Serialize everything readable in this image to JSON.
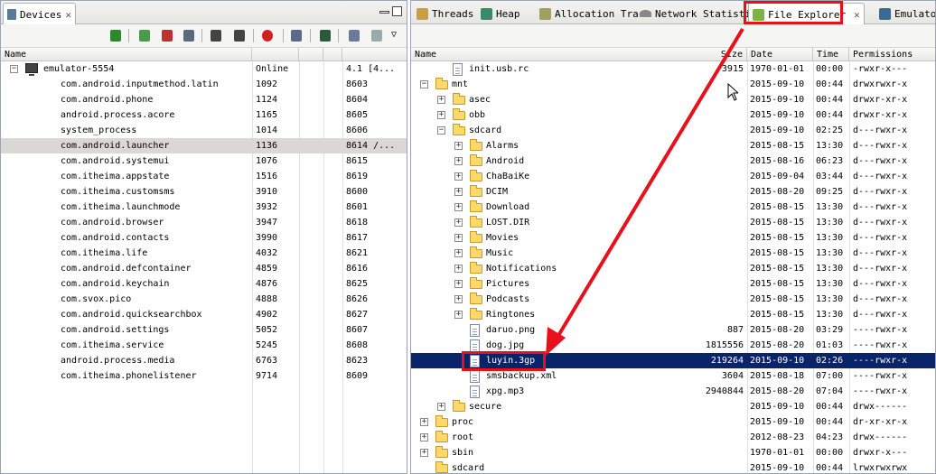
{
  "colors": {
    "accent_red": "#e8101a",
    "selection": "#0a246a",
    "highlight_row": "#d9d8d4"
  },
  "devices_view": {
    "tab_label": "Devices",
    "columns": [
      "Name",
      "",
      "",
      ""
    ],
    "toolbar_icons": [
      "debug-bug-icon",
      "update-heap-icon",
      "dump-hprof-icon",
      "cause-gc-icon",
      "update-threads-icon",
      "start-method-profiling-icon",
      "stop-process-icon",
      "screen-capture-icon",
      "systrace-icon",
      "opengl-trace-icon",
      "reset-adb-icon",
      "view-menu-icon"
    ],
    "rows": [
      {
        "name": "emulator-5554",
        "pid": "Online",
        "port": "4.1 [4...",
        "kind": "device"
      },
      {
        "name": "com.android.inputmethod.latin",
        "pid": "1092",
        "port": "8603"
      },
      {
        "name": "com.android.phone",
        "pid": "1124",
        "port": "8604"
      },
      {
        "name": "android.process.acore",
        "pid": "1165",
        "port": "8605"
      },
      {
        "name": "system_process",
        "pid": "1014",
        "port": "8606"
      },
      {
        "name": "com.android.launcher",
        "pid": "1136",
        "port": "8614 /...",
        "highlight": true
      },
      {
        "name": "com.android.systemui",
        "pid": "1076",
        "port": "8615"
      },
      {
        "name": "com.itheima.appstate",
        "pid": "1516",
        "port": "8619"
      },
      {
        "name": "com.itheima.customsms",
        "pid": "3910",
        "port": "8600"
      },
      {
        "name": "com.itheima.launchmode",
        "pid": "3932",
        "port": "8601"
      },
      {
        "name": "com.android.browser",
        "pid": "3947",
        "port": "8618"
      },
      {
        "name": "com.android.contacts",
        "pid": "3990",
        "port": "8617"
      },
      {
        "name": "com.itheima.life",
        "pid": "4032",
        "port": "8621"
      },
      {
        "name": "com.android.defcontainer",
        "pid": "4859",
        "port": "8616"
      },
      {
        "name": "com.android.keychain",
        "pid": "4876",
        "port": "8625"
      },
      {
        "name": "com.svox.pico",
        "pid": "4888",
        "port": "8626"
      },
      {
        "name": "com.android.quicksearchbox",
        "pid": "4902",
        "port": "8627"
      },
      {
        "name": "com.android.settings",
        "pid": "5052",
        "port": "8607"
      },
      {
        "name": "com.itheima.service",
        "pid": "5245",
        "port": "8608"
      },
      {
        "name": "android.process.media",
        "pid": "6763",
        "port": "8623"
      },
      {
        "name": "com.itheima.phonelistener",
        "pid": "9714",
        "port": "8609"
      }
    ]
  },
  "tabs_right": [
    {
      "label": "Threads",
      "icon": "threads-icon"
    },
    {
      "label": "Heap",
      "icon": "heap-icon"
    },
    {
      "label": "Allocation Track",
      "icon": "allocation-icon"
    },
    {
      "label": "Network Statisti",
      "icon": "network-icon"
    },
    {
      "label": "File Explorer",
      "icon": "android-icon",
      "active": true
    },
    {
      "label": "Emulato",
      "icon": "emulator-icon"
    }
  ],
  "file_explorer": {
    "columns": [
      "Name",
      "Size",
      "Date",
      "Time",
      "Permissions"
    ],
    "rows": [
      {
        "name": "init.usb.rc",
        "size": "3915",
        "date": "1970-01-01",
        "time": "00:00",
        "perm": "-rwxr-x---",
        "type": "file",
        "depth": 1
      },
      {
        "name": "mnt",
        "size": "",
        "date": "2015-09-10",
        "time": "00:44",
        "perm": "drwxrwxr-x",
        "type": "folder",
        "depth": 0,
        "expand": "-"
      },
      {
        "name": "asec",
        "size": "",
        "date": "2015-09-10",
        "time": "00:44",
        "perm": "drwxr-xr-x",
        "type": "folder",
        "depth": 1,
        "expand": "+"
      },
      {
        "name": "obb",
        "size": "",
        "date": "2015-09-10",
        "time": "00:44",
        "perm": "drwxr-xr-x",
        "type": "folder",
        "depth": 1,
        "expand": "+"
      },
      {
        "name": "sdcard",
        "size": "",
        "date": "2015-09-10",
        "time": "02:25",
        "perm": "d---rwxr-x",
        "type": "folder",
        "depth": 1,
        "expand": "-"
      },
      {
        "name": "Alarms",
        "size": "",
        "date": "2015-08-15",
        "time": "13:30",
        "perm": "d---rwxr-x",
        "type": "folder",
        "depth": 2,
        "expand": "+"
      },
      {
        "name": "Android",
        "size": "",
        "date": "2015-08-16",
        "time": "06:23",
        "perm": "d---rwxr-x",
        "type": "folder",
        "depth": 2,
        "expand": "+"
      },
      {
        "name": "ChaBaiKe",
        "size": "",
        "date": "2015-09-04",
        "time": "03:44",
        "perm": "d---rwxr-x",
        "type": "folder",
        "depth": 2,
        "expand": "+"
      },
      {
        "name": "DCIM",
        "size": "",
        "date": "2015-08-20",
        "time": "09:25",
        "perm": "d---rwxr-x",
        "type": "folder",
        "depth": 2,
        "expand": "+"
      },
      {
        "name": "Download",
        "size": "",
        "date": "2015-08-15",
        "time": "13:30",
        "perm": "d---rwxr-x",
        "type": "folder",
        "depth": 2,
        "expand": "+"
      },
      {
        "name": "LOST.DIR",
        "size": "",
        "date": "2015-08-15",
        "time": "13:30",
        "perm": "d---rwxr-x",
        "type": "folder",
        "depth": 2,
        "expand": "+"
      },
      {
        "name": "Movies",
        "size": "",
        "date": "2015-08-15",
        "time": "13:30",
        "perm": "d---rwxr-x",
        "type": "folder",
        "depth": 2,
        "expand": "+"
      },
      {
        "name": "Music",
        "size": "",
        "date": "2015-08-15",
        "time": "13:30",
        "perm": "d---rwxr-x",
        "type": "folder",
        "depth": 2,
        "expand": "+"
      },
      {
        "name": "Notifications",
        "size": "",
        "date": "2015-08-15",
        "time": "13:30",
        "perm": "d---rwxr-x",
        "type": "folder",
        "depth": 2,
        "expand": "+"
      },
      {
        "name": "Pictures",
        "size": "",
        "date": "2015-08-15",
        "time": "13:30",
        "perm": "d---rwxr-x",
        "type": "folder",
        "depth": 2,
        "expand": "+"
      },
      {
        "name": "Podcasts",
        "size": "",
        "date": "2015-08-15",
        "time": "13:30",
        "perm": "d---rwxr-x",
        "type": "folder",
        "depth": 2,
        "expand": "+"
      },
      {
        "name": "Ringtones",
        "size": "",
        "date": "2015-08-15",
        "time": "13:30",
        "perm": "d---rwxr-x",
        "type": "folder",
        "depth": 2,
        "expand": "+"
      },
      {
        "name": "daruo.png",
        "size": "887",
        "date": "2015-08-20",
        "time": "03:29",
        "perm": "----rwxr-x",
        "type": "file",
        "depth": 2
      },
      {
        "name": "dog.jpg",
        "size": "1815556",
        "date": "2015-08-20",
        "time": "01:03",
        "perm": "----rwxr-x",
        "type": "file",
        "depth": 2
      },
      {
        "name": "luyin.3gp",
        "size": "219264",
        "date": "2015-09-10",
        "time": "02:26",
        "perm": "----rwxr-x",
        "type": "file",
        "depth": 2,
        "selected": true
      },
      {
        "name": "smsbackup.xml",
        "size": "3604",
        "date": "2015-08-18",
        "time": "07:00",
        "perm": "----rwxr-x",
        "type": "file",
        "depth": 2
      },
      {
        "name": "xpg.mp3",
        "size": "2940844",
        "date": "2015-08-20",
        "time": "07:04",
        "perm": "----rwxr-x",
        "type": "file",
        "depth": 2
      },
      {
        "name": "secure",
        "size": "",
        "date": "2015-09-10",
        "time": "00:44",
        "perm": "drwx------",
        "type": "folder",
        "depth": 1,
        "expand": "+"
      },
      {
        "name": "proc",
        "size": "",
        "date": "2015-09-10",
        "time": "00:44",
        "perm": "dr-xr-xr-x",
        "type": "folder",
        "depth": 0,
        "expand": "+"
      },
      {
        "name": "root",
        "size": "",
        "date": "2012-08-23",
        "time": "04:23",
        "perm": "drwx------",
        "type": "folder",
        "depth": 0,
        "expand": "+"
      },
      {
        "name": "sbin",
        "size": "",
        "date": "1970-01-01",
        "time": "00:00",
        "perm": "drwxr-x---",
        "type": "folder",
        "depth": 0,
        "expand": "+"
      },
      {
        "name": "sdcard",
        "size": "",
        "date": "2015-09-10",
        "time": "00:44",
        "perm": "lrwxrwxrwx",
        "type": "link",
        "depth": 0
      }
    ]
  }
}
